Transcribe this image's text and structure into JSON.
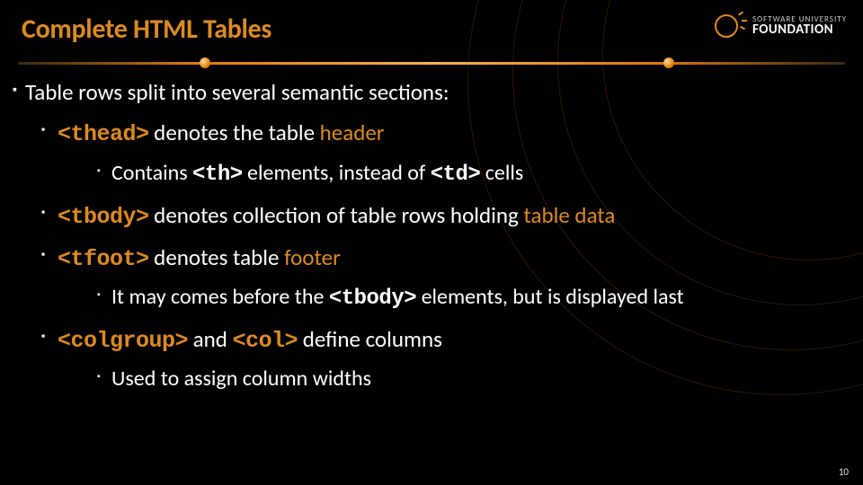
{
  "logo": {
    "line1": "SOFTWARE UNIVERSITY",
    "line2": "FOUNDATION"
  },
  "title": "Complete HTML Tables",
  "bullets": {
    "intro": "Table rows split into several semantic sections:",
    "thead": {
      "tag": "<thead>",
      "rest_a": " denotes the table ",
      "hl": "header",
      "sub_a": "Contains ",
      "sub_th": "<th>",
      "sub_b": " elements, instead of ",
      "sub_td": "<td>",
      "sub_c": " cells"
    },
    "tbody": {
      "tag": "<tbody>",
      "rest_a": " denotes collection of table rows holding ",
      "hl": "table data"
    },
    "tfoot": {
      "tag": "<tfoot>",
      "rest_a": " denotes table ",
      "hl": "footer",
      "sub_a": "It may comes before the ",
      "sub_tag": "<tbody>",
      "sub_b": " elements, but is displayed last"
    },
    "colgroup": {
      "tag1": "<colgroup>",
      "mid": " and ",
      "tag2": "<col>",
      "rest": " define columns",
      "sub": "Used to assign column widths"
    }
  },
  "page_number": "10"
}
